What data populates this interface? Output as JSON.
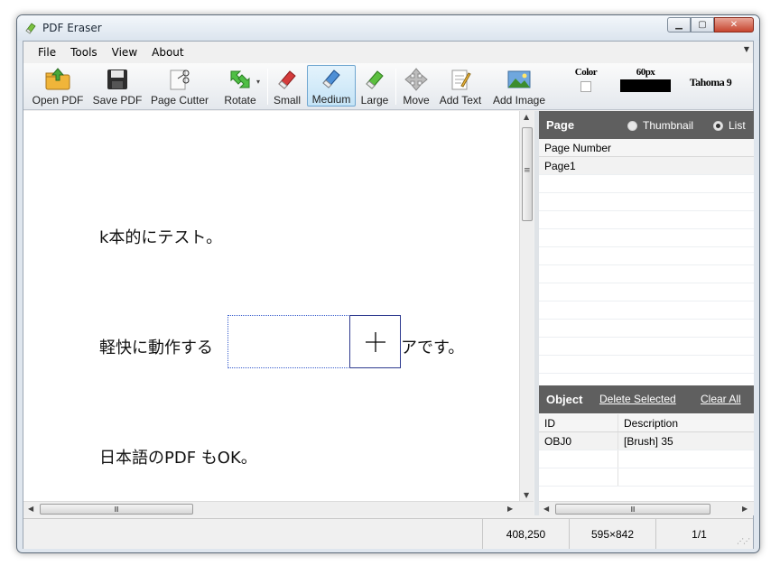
{
  "window": {
    "title": "PDF Eraser"
  },
  "menu": [
    "File",
    "Tools",
    "View",
    "About"
  ],
  "toolbar": {
    "open_pdf": "Open PDF",
    "save_pdf": "Save PDF",
    "page_cutter": "Page Cutter",
    "rotate": "Rotate",
    "small": "Small",
    "medium": "Medium",
    "large": "Large",
    "move": "Move",
    "add_text": "Add Text",
    "add_image": "Add Image",
    "color_label": "Color",
    "size_label": "60px",
    "font_label": "Tahoma 9",
    "active_tool": "Medium"
  },
  "document": {
    "lines": [
      "k本的にテスト。",
      "軽快に動作する",
      "アです。",
      "日本語のPDF もOK。"
    ]
  },
  "page_panel": {
    "title": "Page",
    "view_options": [
      "Thumbnail",
      "List"
    ],
    "selected_view": "List",
    "column": "Page Number",
    "rows": [
      "Page1"
    ]
  },
  "object_panel": {
    "title": "Object",
    "delete_selected": "Delete Selected",
    "clear_all": "Clear All",
    "columns": [
      "ID",
      "Description"
    ],
    "rows": [
      {
        "id": "OBJ0",
        "description": "[Brush] 35"
      }
    ]
  },
  "status": {
    "coords": "408,250",
    "page_size": "595×842",
    "page_index": "1/1"
  },
  "scroll": {
    "h_thumb_glyph": "Ⅲ",
    "v_thumb_glyph": "≡"
  },
  "colors": {
    "accent_active": "#c4e3f6",
    "panel_header": "#5f5f5f",
    "selection_border": "#3a5fcd"
  }
}
